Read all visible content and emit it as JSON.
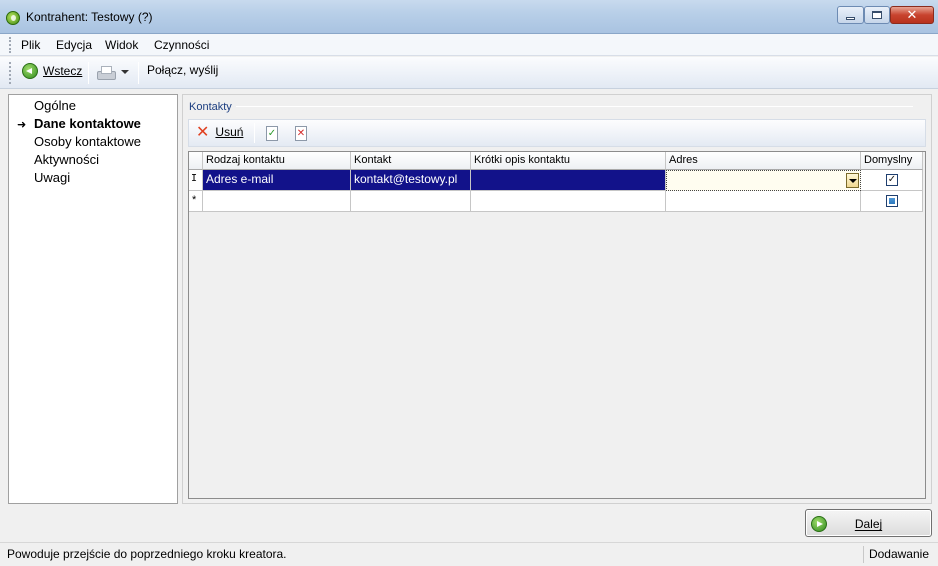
{
  "window": {
    "title": "Kontrahent: Testowy (?)",
    "controls": {
      "minimize": "min",
      "maximize": "max",
      "close": "✕"
    }
  },
  "menu": {
    "items": [
      {
        "label": "Plik"
      },
      {
        "label": "Edycja"
      },
      {
        "label": "Widok"
      },
      {
        "label": "Czynności"
      }
    ]
  },
  "toolbar": {
    "back_label": "Wstecz",
    "connect_label": "Połącz, wyślij",
    "back_icon": "back-arrow-icon",
    "print_icon": "printer-icon"
  },
  "nav": {
    "items": [
      {
        "label": "Ogólne",
        "active": false
      },
      {
        "label": "Dane kontaktowe",
        "active": true
      },
      {
        "label": "Osoby kontaktowe",
        "active": false
      },
      {
        "label": "Aktywności",
        "active": false
      },
      {
        "label": "Uwagi",
        "active": false
      }
    ],
    "active_marker": "➜"
  },
  "contacts": {
    "group_label": "Kontakty",
    "toolbar": {
      "delete_label": "Usuń",
      "accept_icon": "✓",
      "cancel_icon": "✕"
    },
    "columns": [
      "Rodzaj kontaktu",
      "Kontakt",
      "Krótki opis kontaktu",
      "Adres",
      "Domyslny"
    ],
    "rows": [
      {
        "marker": "I",
        "type": "Adres e-mail",
        "contact": "kontakt@testowy.pl",
        "description": "",
        "address": "",
        "default": "✓"
      }
    ],
    "new_row_marker": "*"
  },
  "footer": {
    "next_label": "Dalej",
    "status_text": "Powoduje przejście do poprzedniego kroku kreatora.",
    "mode_text": "Dodawanie"
  },
  "colors": {
    "selection": "#12128a",
    "titlebar": "#b8cfe8",
    "group_label": "#1c3e80"
  }
}
